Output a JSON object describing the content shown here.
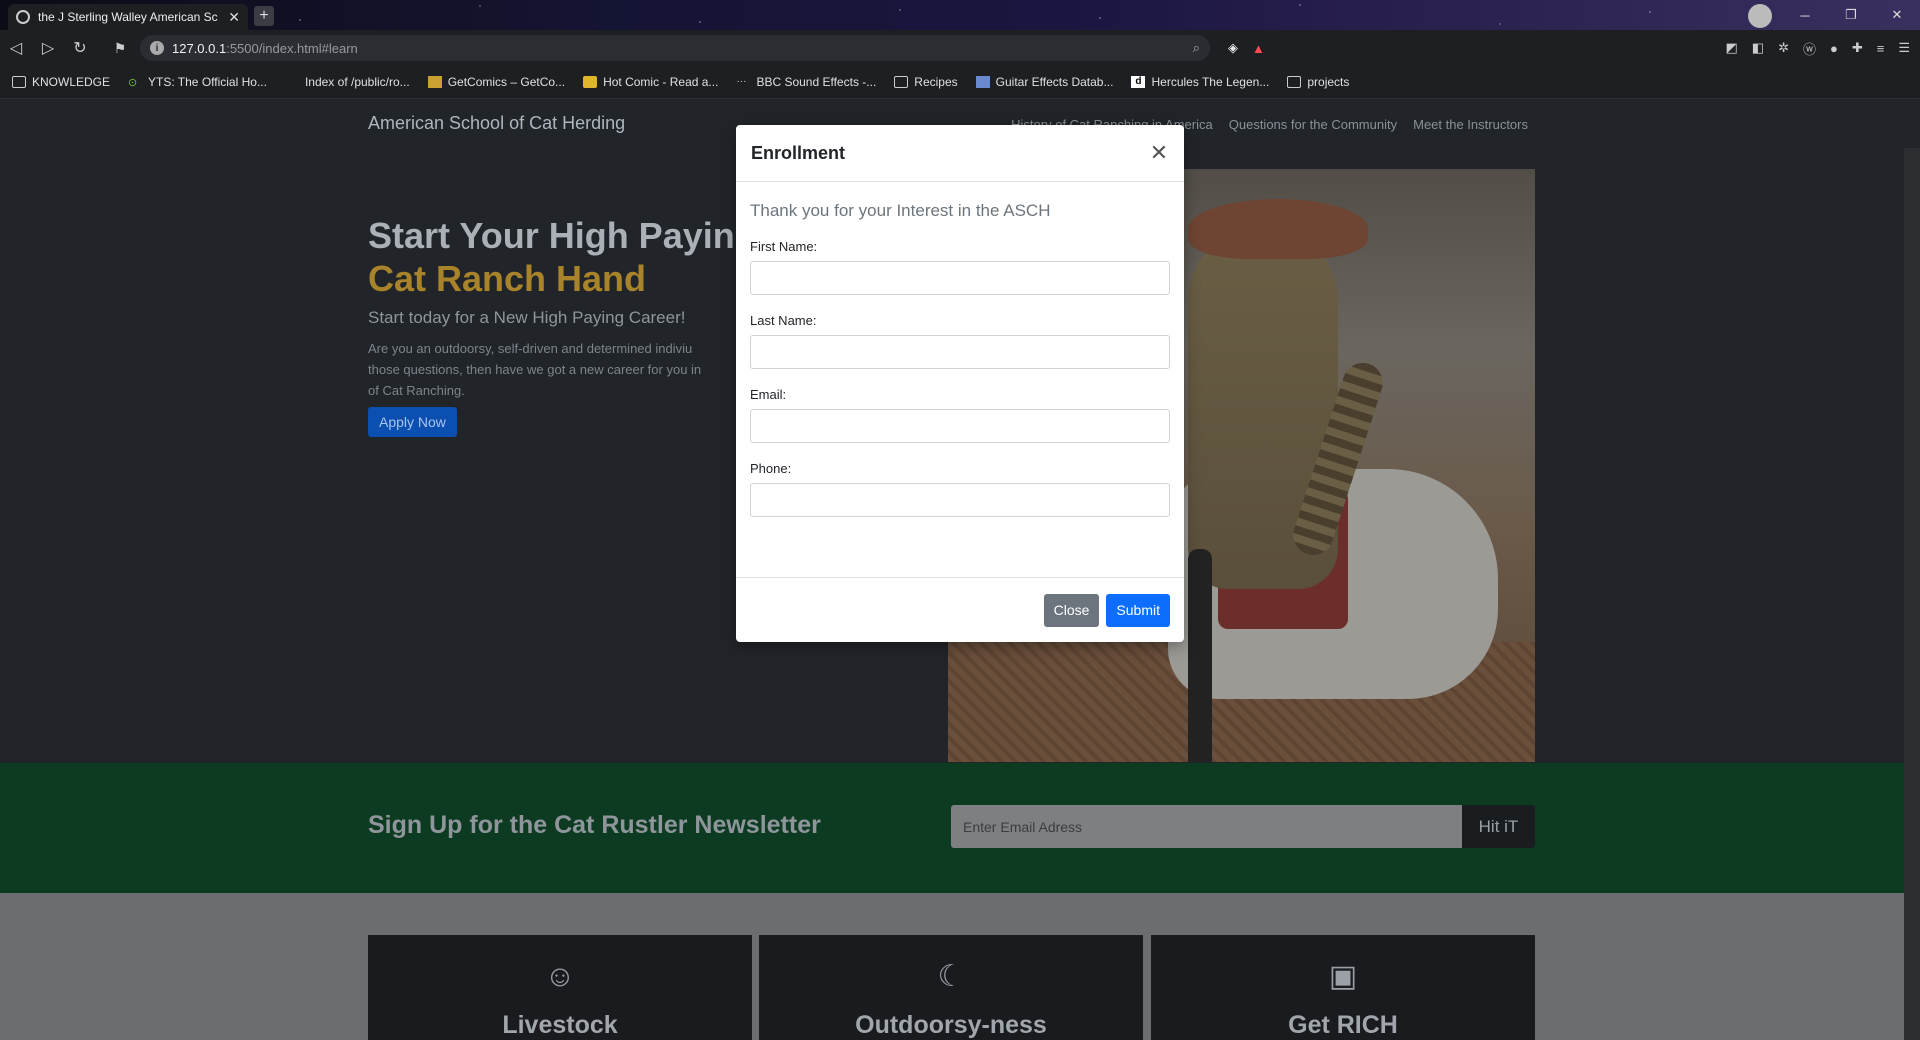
{
  "browser": {
    "tab_title": "the J Sterling Walley American Sc",
    "url_host": "127.0.0.1",
    "url_path": ":5500/index.html#learn",
    "bookmarks": [
      {
        "label": "KNOWLEDGE",
        "icon": "folder-icon"
      },
      {
        "label": "YTS: The Official Ho...",
        "icon": "yts-icon"
      },
      {
        "label": "Index of /public/ro...",
        "icon": "page-icon"
      },
      {
        "label": "GetComics – GetCo...",
        "icon": "getcomics-icon"
      },
      {
        "label": "Hot Comic - Read a...",
        "icon": "hotcomic-icon"
      },
      {
        "label": "BBC Sound Effects -...",
        "icon": "bbc-icon"
      },
      {
        "label": "Recipes",
        "icon": "folder-icon"
      },
      {
        "label": "Guitar Effects Datab...",
        "icon": "guitar-icon"
      },
      {
        "label": "Hercules The Legen...",
        "icon": "dailymotion-icon"
      },
      {
        "label": "projects",
        "icon": "folder-icon"
      }
    ]
  },
  "site": {
    "brand": "American School of Cat Herding",
    "nav": [
      "History of Cat Ranching in America",
      "Questions for the Community",
      "Meet the Instructors"
    ],
    "hero": {
      "title_part1": "Start Your High Paying",
      "title_part2": "Cat Ranch Hand",
      "lead": "Start today for a New High Paying Career!",
      "body_line1": "Are you an outdoorsy, self-driven and determined indiviu",
      "body_line2": "those questions, then have we got a new career for you in",
      "body_line3": "of Cat Ranching.",
      "apply_label": "Apply Now"
    },
    "newsletter": {
      "heading": "Sign Up for the Cat Rustler Newsletter",
      "placeholder": "Enter Email Adress",
      "button": "Hit iT"
    },
    "features": [
      {
        "title": "Livestock",
        "icon": "smile-icon"
      },
      {
        "title": "Outdoorsy-ness",
        "icon": "moon-icon"
      },
      {
        "title": "Get RICH",
        "icon": "cash-icon"
      }
    ]
  },
  "modal": {
    "title": "Enrollment",
    "lead": "Thank you for your Interest in the ASCH",
    "fields": [
      {
        "label": "First Name:",
        "value": ""
      },
      {
        "label": "Last Name:",
        "value": ""
      },
      {
        "label": "Email:",
        "value": ""
      },
      {
        "label": "Phone:",
        "value": ""
      }
    ],
    "close_label": "Close",
    "submit_label": "Submit"
  },
  "colors": {
    "accent_gold": "#a8832a",
    "newsletter_bg": "#0d3b21",
    "primary": "#0d6efd",
    "secondary": "#6c757d"
  }
}
